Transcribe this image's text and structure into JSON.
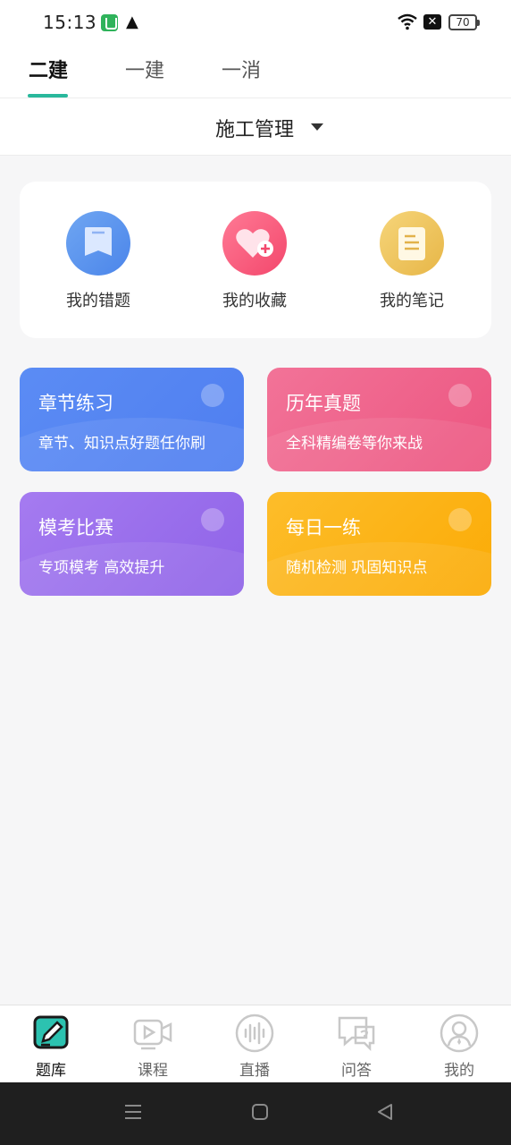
{
  "status_bar": {
    "time": "15:13",
    "battery": "70",
    "icons": [
      "app-notification-icon",
      "warning-icon",
      "wifi-icon",
      "no-sim-icon",
      "battery-icon"
    ]
  },
  "top_tabs": [
    {
      "label": "二建",
      "active": true
    },
    {
      "label": "一建",
      "active": false
    },
    {
      "label": "一消",
      "active": false
    }
  ],
  "subject": {
    "label": "施工管理"
  },
  "quick_actions": [
    {
      "label": "我的错题",
      "icon": "bookmark-icon",
      "color": "#5b95ee"
    },
    {
      "label": "我的收藏",
      "icon": "heart-plus-icon",
      "color": "#f5587a"
    },
    {
      "label": "我的笔记",
      "icon": "note-icon",
      "color": "#ecc25a"
    }
  ],
  "features": [
    {
      "title": "章节练习",
      "subtitle": "章节、知识点好题任你刷",
      "color": "#5685f2"
    },
    {
      "title": "历年真题",
      "subtitle": "全科精编卷等你来战",
      "color": "#ee5f88"
    },
    {
      "title": "模考比赛",
      "subtitle": "专项模考 高效提升",
      "color": "#9a6eec"
    },
    {
      "title": "每日一练",
      "subtitle": "随机检测 巩固知识点",
      "color": "#fcb418"
    }
  ],
  "bottom_nav": [
    {
      "label": "题库",
      "icon": "question-bank-icon",
      "active": true
    },
    {
      "label": "课程",
      "icon": "video-course-icon",
      "active": false
    },
    {
      "label": "直播",
      "icon": "live-audio-icon",
      "active": false
    },
    {
      "label": "问答",
      "icon": "qa-chat-icon",
      "active": false
    },
    {
      "label": "我的",
      "icon": "profile-icon",
      "active": false
    }
  ],
  "colors": {
    "accent": "#29b89c",
    "background": "#f6f6f7"
  }
}
